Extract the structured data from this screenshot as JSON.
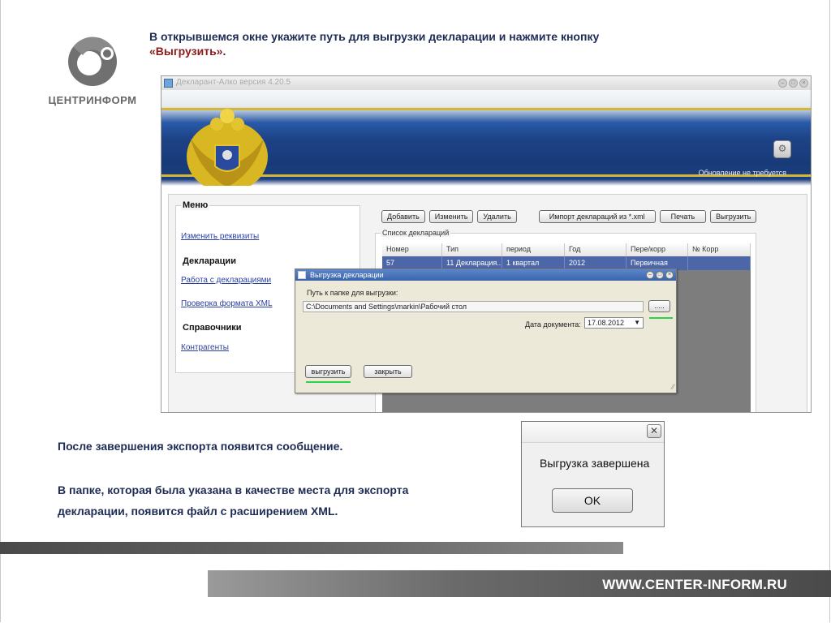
{
  "logo": {
    "text": "ЦЕНТРИНФОРМ"
  },
  "instruction": {
    "line1": "В открывшемся окне укажите путь для выгрузки декларации  и нажмите кнопку",
    "line2_highlight": "«Выгрузить»",
    "line2_tail": "."
  },
  "app": {
    "title": "Декларант-Алко версия 4.20.5",
    "update_status": "Обновление не требуется",
    "menu": {
      "legend": "Меню",
      "change_details": "Изменить реквизиты",
      "declarations_heading": "Декларации",
      "work_with_declarations": "Работа с декларациями",
      "check_xml": "Проверка формата XML",
      "references_heading": "Справочники",
      "contractors": "Контрагенты"
    },
    "toolbar": {
      "add": "Добавить",
      "edit": "Изменить",
      "delete": "Удалить",
      "import": "Импорт деклараций из *.xml",
      "print": "Печать",
      "export": "Выгрузить"
    },
    "list": {
      "legend": "Список деклараций",
      "columns": [
        "Номер",
        "Тип",
        "период",
        "Год",
        "Пере/корр",
        "№ Корр"
      ],
      "row": [
        "57",
        "11 Декларация...",
        "1 квартал",
        "2012",
        "Первичная",
        ""
      ]
    }
  },
  "export_dialog": {
    "title": "Выгрузка декларации",
    "path_label": "Путь к папке для выгрузки:",
    "path_value": "C:\\Documents and Settings\\markin\\Рабочий стол",
    "browse": ".....",
    "date_label": "Дата документа:",
    "date_value": "17.08.2012",
    "export_button": "выгрузить",
    "close_button": "закрыть"
  },
  "texts": {
    "after_export": "После завершения экспорта появится сообщение.",
    "file_line1": "В папке, которая была указана в качестве места для экспорта",
    "file_line2": "декларации, появится файл с расширением XML."
  },
  "message_box": {
    "close": "✕",
    "text": "Выгрузка завершена",
    "ok": "OK"
  },
  "footer": {
    "url": "WWW.CENTER-INFORM.RU"
  },
  "colors": {
    "accent_green": "#2bd34a",
    "title_text": "#1d2b55",
    "highlight": "#8b1a1a"
  }
}
